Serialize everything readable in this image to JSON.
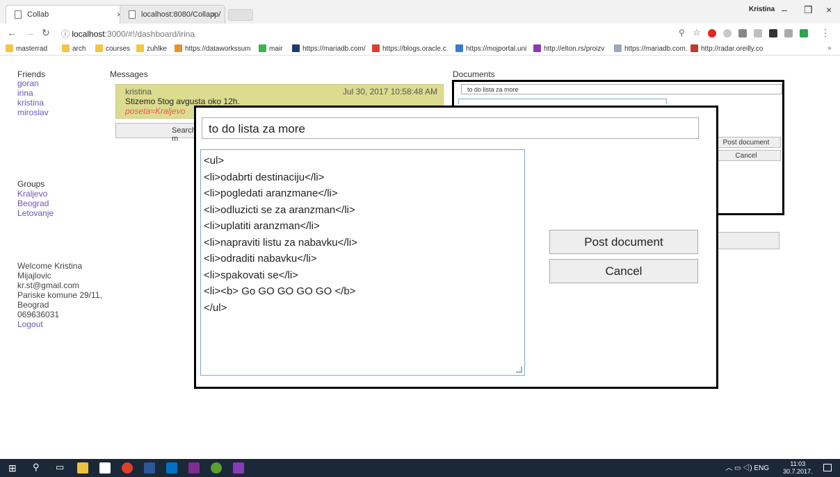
{
  "browser": {
    "tabs": [
      {
        "title": "Collab"
      },
      {
        "title": "localhost:8080/Collapp/"
      }
    ],
    "profile_name": "Kristina",
    "address": {
      "host": "localhost",
      "path": ":3000/#!/dashboard/irina"
    },
    "bookmarks": [
      {
        "label": "masterrad",
        "color": "#f4c542"
      },
      {
        "label": "arch",
        "color": "#f4c542"
      },
      {
        "label": "courses",
        "color": "#f4c542"
      },
      {
        "label": "zuhlke",
        "color": "#f4c542"
      },
      {
        "label": "https://dataworkssum",
        "color": "#e8912d"
      },
      {
        "label": "mair",
        "color": "#3bb54a"
      },
      {
        "label": "https://mariadb.com/",
        "color": "#1f3b6e"
      },
      {
        "label": "https://blogs.oracle.c",
        "color": "#e03c31"
      },
      {
        "label": "https://mojportal.uni",
        "color": "#3a7dc9"
      },
      {
        "label": "http://elton.rs/proizv",
        "color": "#8a3ab9"
      },
      {
        "label": "https://mariadb.com.",
        "color": "#9aa7c0"
      },
      {
        "label": "http://radar.oreilly.co",
        "color": "#c0392b"
      }
    ]
  },
  "friends": {
    "heading": "Friends",
    "items": [
      "goran",
      "irina",
      "kristina",
      "miroslav"
    ]
  },
  "groups": {
    "heading": "Groups",
    "items": [
      "Kraljevo",
      "Beograd",
      "Letovanje"
    ]
  },
  "profile": {
    "welcome": "Welcome Kristina",
    "surname": "Mijajlovic",
    "email": "kr.st@gmail.com",
    "street": "Pariske komune 29/11,",
    "city": "Beograd",
    "phone": "069636031",
    "logout": "Logout"
  },
  "messages": {
    "heading": "Messages",
    "items": [
      {
        "sender": "kristina",
        "date": "Jul 30, 2017 10:58:48 AM",
        "body": "Stizemo 5tog avgusta oko 12h.",
        "tag": "poseta=Kraljevo"
      }
    ],
    "search_label": "Search m"
  },
  "documents": {
    "heading": "Documents",
    "title_value": "to do lista za more",
    "post_label": "Post document",
    "cancel_label": "Cancel"
  },
  "modal": {
    "title_value": "to do lista za more",
    "body_lines": [
      "<ul>",
      "<li>odabrti destinaciju</li>",
      "<li>pogledati aranzmane</li>",
      "<li>odluzicti se za aranzman</li>",
      "<li>uplatiti aranzman</li>",
      "<li>napraviti listu za nabavku</li>",
      "<li>odraditi nabavku</li>",
      "<li>spakovati se</li>",
      "<li><b> Go GO GO GO GO </b>",
      "</ul>"
    ],
    "post_label": "Post document",
    "cancel_label": "Cancel"
  },
  "taskbar": {
    "lang": "ENG",
    "time": "11:03",
    "date": "30.7.2017."
  }
}
